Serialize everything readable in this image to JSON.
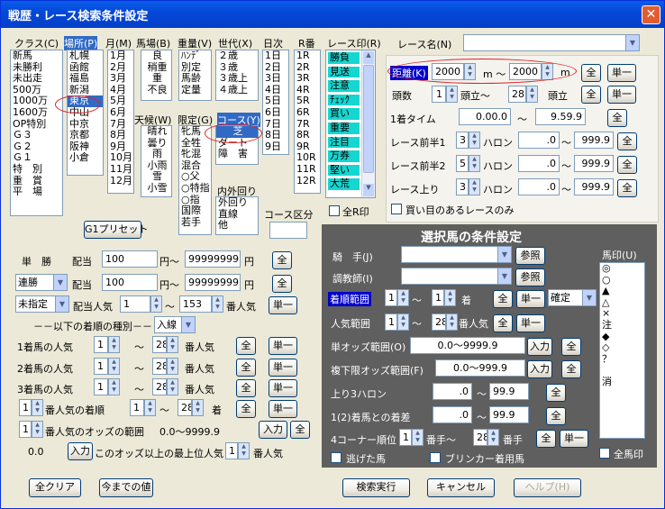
{
  "window": {
    "title": "戦歴・レース検索条件設定",
    "close": "✕"
  },
  "top": {
    "class_hdr": "クラス(C)",
    "class_items": [
      "新馬",
      "未勝利",
      "未出走",
      "500万",
      "1000万",
      "1600万",
      "OP特別",
      "Ｇ３",
      "Ｇ２",
      "Ｇ１",
      "特　別",
      "重　賞",
      "平　場"
    ],
    "place_hdr": "場所(P)",
    "place_items": [
      "札幌",
      "函館",
      "福島",
      "新潟",
      "東京",
      "中山",
      "中京",
      "京都",
      "阪神",
      "小倉"
    ],
    "month_hdr": "月(M)",
    "month_items": [
      "1月",
      "2月",
      "3月",
      "4月",
      "5月",
      "6月",
      "7月",
      "8月",
      "9月",
      "10月",
      "11月",
      "12月"
    ],
    "track_hdr": "馬場(B)",
    "track_items": [
      "良",
      "稍重",
      "重",
      "不良"
    ],
    "weather_hdr": "天候(W)",
    "weather_items": [
      "晴れ",
      "曇り",
      "雨",
      "小雨",
      "雪",
      "小雪"
    ],
    "weight_hdr": "重量(V)",
    "weight_items": [
      "ﾊﾝﾃﾞ",
      "別定",
      "馬齢",
      "定量"
    ],
    "gen_hdr": "世代(X)",
    "gen_items": [
      "２歳",
      "３歳",
      "３歳上",
      "４歳上"
    ],
    "limit_hdr": "限定(G)",
    "limit_items": [
      "牝馬",
      "全牲",
      "牝混",
      "混合",
      "○父",
      "○特指",
      "○指",
      "国際",
      "若手"
    ],
    "course_hdr": "コース(Y)",
    "course_items": [
      "芝",
      "ダート",
      "障　害"
    ],
    "inout_hdr": "内外回り",
    "inout_items": [
      "外回り",
      "直線",
      "他"
    ],
    "course_kubun": "コース区分",
    "day_hdr": "日次",
    "day_items": [
      "1日",
      "2日",
      "3日",
      "4日",
      "5日",
      "6日",
      "7日",
      "8日",
      "9日"
    ],
    "r_hdr": "R番",
    "r_items": [
      "1R",
      "2R",
      "3R",
      "4R",
      "5R",
      "6R",
      "7R",
      "8R",
      "9R",
      "10R",
      "11R",
      "12R"
    ],
    "race_mark_hdr": "レース印(R)",
    "race_mark_items": [
      "勝負",
      "見送",
      "注意",
      "ﾁｪｯｸ",
      "買い",
      "重要",
      "注目",
      "万券",
      "堅い",
      "大荒"
    ],
    "all_r_mark": "全R印",
    "g1_preset": "G1プリセット"
  },
  "right": {
    "race_name": "レース名(N)",
    "distance": "距離(K)",
    "dist_from": "2000",
    "dist_to": "2000",
    "m": "m",
    "tilde": "～",
    "zen": "全",
    "tan": "単一",
    "tousu": "頭数",
    "tousu_from": "1",
    "tousu_mid": "頭立～",
    "tousu_to": "28",
    "tousu_end": "頭立",
    "time1": "1着タイム",
    "time_from": "0.00.0",
    "time_to": "9.59.9",
    "zen1": "レース前半1",
    "zen1_v": "3",
    "furlong": "ハロン",
    "zen1_a": ".0",
    "zen1_b": "999.9",
    "zen2": "レース前半2",
    "zen2_v": "5",
    "zen2_a": ".0",
    "zen2_b": "999.9",
    "agari": "レース上り",
    "agari_v": "3",
    "agari_a": ".0",
    "agari_b": "999.9",
    "buy_only": "買い目のあるレースのみ"
  },
  "odds": {
    "tansho": "単　勝",
    "haito": "配当",
    "t_from": "100",
    "yen": "円～",
    "t_to": "99999999",
    "yen2": "円",
    "rempuku": "連勝",
    "r_from": "100",
    "r_to": "99999999",
    "shitei": "未指定",
    "haito_ninki": "配当人気",
    "n_from": "1",
    "n_to": "153",
    "bannin": "番人気",
    "kind_hdr": "－－以下の着順の種別－－",
    "kind_sel": "入線",
    "c1": "1着馬の人気",
    "c2": "2着馬の人気",
    "c3": "3着馬の人気",
    "c_from": "1",
    "c_to": "28",
    "popular_rank": "番人気の着順",
    "pr_v": "1",
    "pr_from": "1",
    "pr_to": "28",
    "chaku": "着",
    "odds_range": "番人気のオッズの範囲",
    "or_v": "1",
    "or_val": "0.0～9999.9",
    "nyuryoku": "入力",
    "min_odds": "0.0",
    "min_text": "このオッズ以上の最上位人気",
    "min_n": "1"
  },
  "horse": {
    "title": "選択馬の条件設定",
    "jockey": "騎　手(J)",
    "trainer": "調教師(I)",
    "sansho": "参照",
    "chaku_range": "着順範囲",
    "cr_from": "1",
    "cr_to": "1",
    "kakutei": "確定",
    "ninki_range": "人気範囲",
    "nr_from": "1",
    "nr_to": "28",
    "tan_odds": "単オッズ範囲(O)",
    "tan_odds_v": "0.0～9999.9",
    "fuku_odds": "複下限オッズ範囲(F)",
    "fuku_odds_v": "0.0～999.9",
    "agari3": "上り3ハロン",
    "a3_from": ".0",
    "a3_to": "99.9",
    "chakusa": "1(2)着馬との着差",
    "cs_from": ".0",
    "cs_to": "99.9",
    "corner4": "4コーナー順位",
    "c4_from": "1",
    "banme": "番手～",
    "c4_to": "28",
    "banme2": "番手",
    "nigeta": "逃げた馬",
    "blinker": "ブリンカー着用馬",
    "mark_hdr": "馬印(U)",
    "marks": [
      "◎",
      "○",
      "▲",
      "△",
      "×",
      "注",
      "◆",
      "◇",
      "？",
      "",
      "消"
    ],
    "all_mark": "全馬印"
  },
  "bottom": {
    "clear": "全クリア",
    "prev": "今までの値",
    "run": "検索実行",
    "cancel": "キャンセル",
    "help": "ヘルプ(H)"
  }
}
